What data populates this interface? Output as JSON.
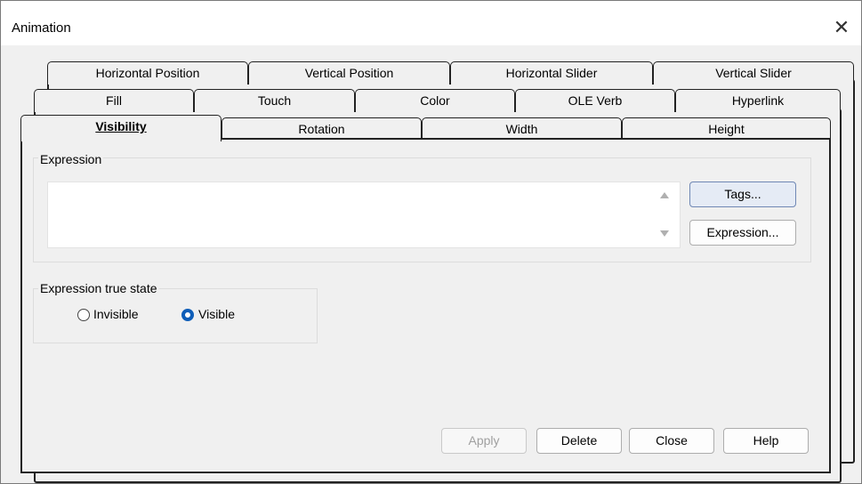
{
  "window": {
    "title": "Animation",
    "close_glyph": "✕"
  },
  "tabs": {
    "row1": [
      {
        "label": "Horizontal Position"
      },
      {
        "label": "Vertical Position"
      },
      {
        "label": "Horizontal Slider"
      },
      {
        "label": "Vertical Slider"
      }
    ],
    "row2": [
      {
        "label": "Fill"
      },
      {
        "label": "Touch"
      },
      {
        "label": "Color"
      },
      {
        "label": "OLE Verb"
      },
      {
        "label": "Hyperlink"
      }
    ],
    "row3": [
      {
        "label": "Visibility"
      },
      {
        "label": "Rotation"
      },
      {
        "label": "Width"
      },
      {
        "label": "Height"
      }
    ],
    "active_tab": "Visibility"
  },
  "expression": {
    "group_label": "Expression",
    "value": "",
    "tags_button": "Tags...",
    "expression_button": "Expression..."
  },
  "true_state": {
    "group_label": "Expression true state",
    "options": [
      {
        "label": "Invisible",
        "checked": false
      },
      {
        "label": "Visible",
        "checked": true
      }
    ]
  },
  "footer": {
    "apply": "Apply",
    "delete": "Delete",
    "close": "Close",
    "help": "Help"
  },
  "colors": {
    "radio_checked": "#0f5eb8",
    "default_button": "#e5ebf5"
  }
}
